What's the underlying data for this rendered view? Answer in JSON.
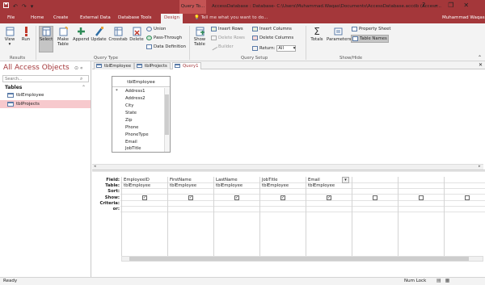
{
  "quick_access": {
    "save_icon": "save-icon",
    "undo": "↶",
    "redo": "↷",
    "customize": "▾"
  },
  "title": {
    "context_tab": "Query To...",
    "text": "AccessDatabase : Database- C:\\Users\\Muhammad.Waqas\\Documents\\AccessDatabase.accdb (Access...",
    "help": "?",
    "minimize": "–",
    "restore": "❐",
    "close": "✕"
  },
  "tabs": [
    "File",
    "Home",
    "Create",
    "External Data",
    "Database Tools",
    "Design"
  ],
  "tell_me": "Tell me what you want to do...",
  "user": "Muhammad Waqas",
  "ribbon": {
    "results": {
      "view": "View",
      "run": "Run",
      "group": "Results"
    },
    "query_type": {
      "select": "Select",
      "make_table": "Make Table",
      "append": "Append",
      "update": "Update",
      "crosstab": "Crosstab",
      "delete": "Delete",
      "union": "Union",
      "pass_through": "Pass-Through",
      "data_definition": "Data Definition",
      "group": "Query Type"
    },
    "query_setup": {
      "show_table": "Show Table",
      "insert_rows": "Insert Rows",
      "delete_rows": "Delete Rows",
      "builder": "Builder",
      "insert_columns": "Insert Columns",
      "delete_columns": "Delete Columns",
      "return_label": "Return:",
      "return_value": "All",
      "group": "Query Setup"
    },
    "show_hide": {
      "totals": "Totals",
      "parameters": "Parameters",
      "property_sheet": "Property Sheet",
      "table_names": "Table Names",
      "group": "Show/Hide"
    }
  },
  "nav": {
    "title": "All Access Objects",
    "search_placeholder": "Search...",
    "section": "Tables",
    "items": [
      "tblEmployee",
      "tblProjects"
    ]
  },
  "doc_tabs": [
    "tblEmployee",
    "tblProjects",
    "Query1"
  ],
  "field_list": {
    "title": "tblEmployee",
    "star": "*",
    "fields": [
      "Address1",
      "Address2",
      "City",
      "State",
      "Zip",
      "Phone",
      "PhoneType",
      "Email",
      "JobTitle"
    ]
  },
  "grid": {
    "row_labels": [
      "Field:",
      "Table:",
      "Sort:",
      "Show:",
      "Criteria:",
      "or:"
    ],
    "columns": [
      {
        "field": "EmployeeID",
        "table": "tblEmployee",
        "show": "✓"
      },
      {
        "field": "FirstName",
        "table": "tblEmployee",
        "show": "✓"
      },
      {
        "field": "LastName",
        "table": "tblEmployee",
        "show": "✓"
      },
      {
        "field": "JobTitle",
        "table": "tblEmployee",
        "show": "✓"
      },
      {
        "field": "Email",
        "table": "tblEmployee",
        "show": "✓"
      },
      {
        "field": "",
        "table": "",
        "show": ""
      },
      {
        "field": "",
        "table": "",
        "show": ""
      },
      {
        "field": "",
        "table": "",
        "show": ""
      }
    ]
  },
  "status": {
    "ready": "Ready",
    "num_lock": "Num Lock"
  }
}
